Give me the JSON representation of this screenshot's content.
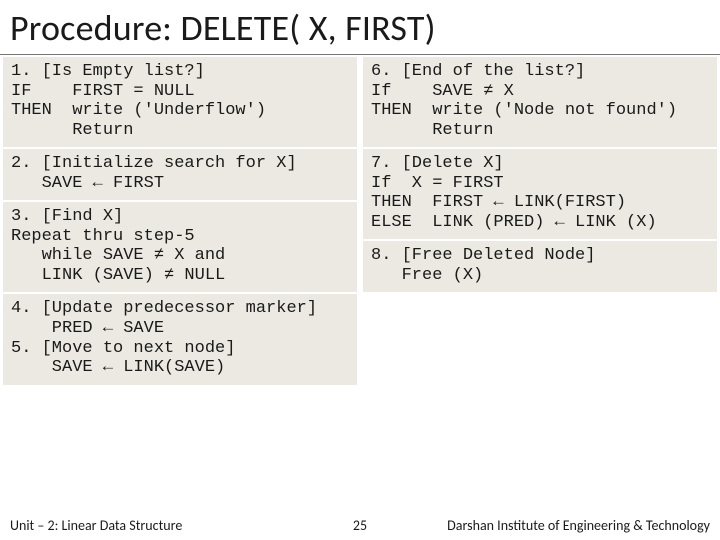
{
  "title": "Procedure: DELETE( X, FIRST)",
  "left": {
    "s1": "1. [Is Empty list?]\nIF    FIRST = NULL\nTHEN  write ('Underflow')\n      Return",
    "s2": "2. [Initialize search for X]\n   SAVE ← FIRST",
    "s3": "3. [Find X]\nRepeat thru step-5\n   while SAVE ≠ X and\n   LINK (SAVE) ≠ NULL",
    "s4": "4. [Update predecessor marker]\n    PRED ← SAVE\n5. [Move to next node]\n    SAVE ← LINK(SAVE)"
  },
  "right": {
    "s6": "6. [End of the list?]\nIf    SAVE ≠ X\nTHEN  write ('Node not found')\n      Return",
    "s7": "7. [Delete X]\nIf  X = FIRST\nTHEN  FIRST ← LINK(FIRST)\nELSE  LINK (PRED) ← LINK (X)",
    "s8": "8. [Free Deleted Node]\n   Free (X)"
  },
  "footer": {
    "left": "Unit – 2: Linear Data Structure",
    "center": "25",
    "right": "Darshan Institute of Engineering & Technology"
  }
}
